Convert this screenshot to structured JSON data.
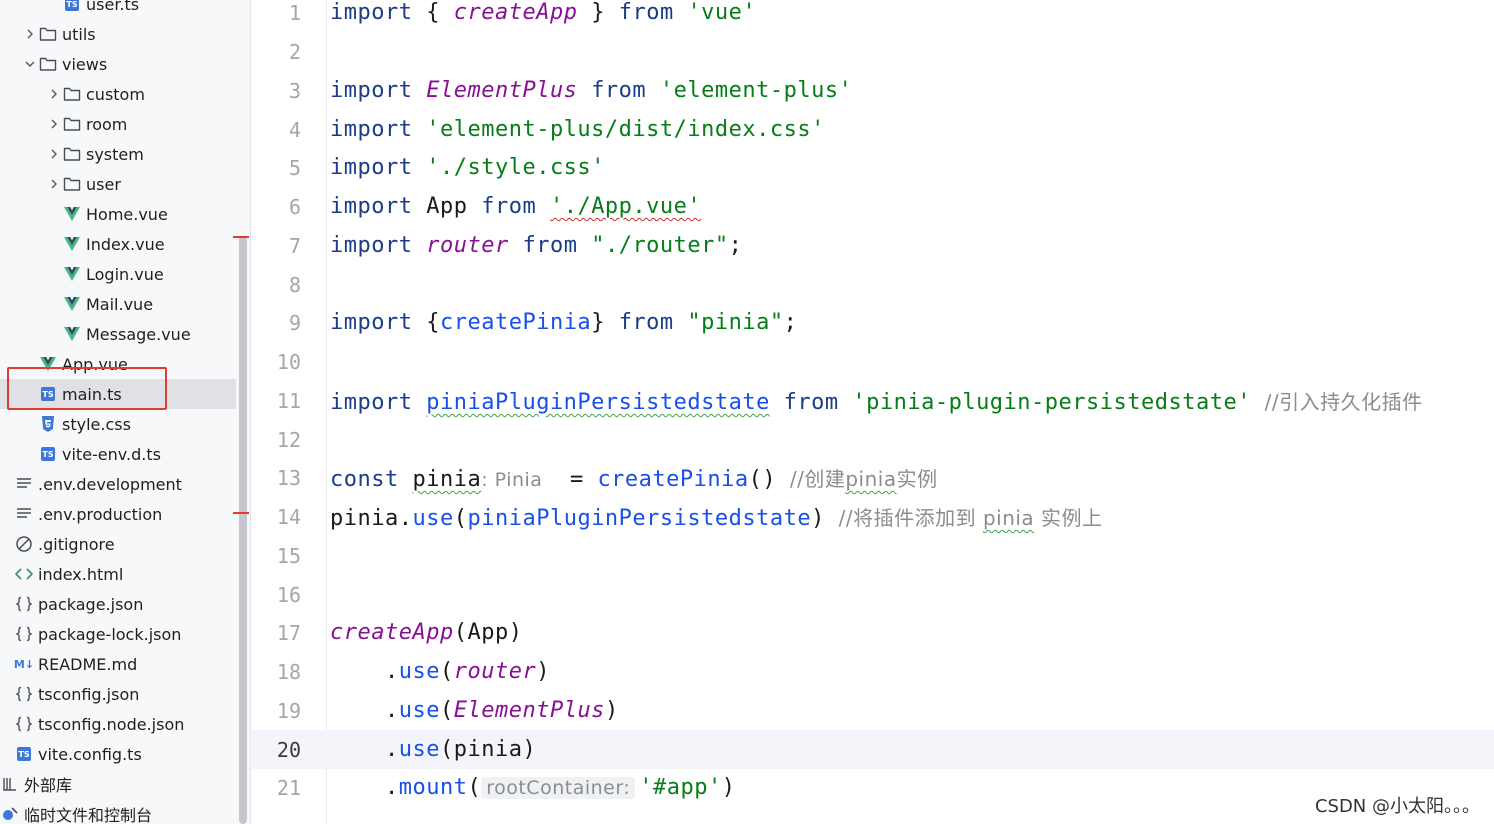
{
  "sidebar": {
    "items": [
      {
        "label": "user.ts",
        "icon": "ts-file-icon",
        "kind": "file",
        "depth": 2
      },
      {
        "label": "utils",
        "icon": "folder-icon",
        "kind": "folder-collapsed",
        "depth": 1
      },
      {
        "label": "views",
        "icon": "folder-icon",
        "kind": "folder-expanded",
        "depth": 1
      },
      {
        "label": "custom",
        "icon": "folder-icon",
        "kind": "folder-collapsed",
        "depth": 2
      },
      {
        "label": "room",
        "icon": "folder-icon",
        "kind": "folder-collapsed",
        "depth": 2
      },
      {
        "label": "system",
        "icon": "folder-icon",
        "kind": "folder-collapsed",
        "depth": 2
      },
      {
        "label": "user",
        "icon": "folder-icon",
        "kind": "folder-collapsed",
        "depth": 2
      },
      {
        "label": "Home.vue",
        "icon": "vue-file-icon",
        "kind": "file",
        "depth": 2
      },
      {
        "label": "Index.vue",
        "icon": "vue-file-icon",
        "kind": "file",
        "depth": 2
      },
      {
        "label": "Login.vue",
        "icon": "vue-file-icon",
        "kind": "file",
        "depth": 2
      },
      {
        "label": "Mail.vue",
        "icon": "vue-file-icon",
        "kind": "file",
        "depth": 2
      },
      {
        "label": "Message.vue",
        "icon": "vue-file-icon",
        "kind": "file",
        "depth": 2
      },
      {
        "label": "App.vue",
        "icon": "vue-file-icon",
        "kind": "file",
        "depth": 1
      },
      {
        "label": "main.ts",
        "icon": "ts-file-icon",
        "kind": "file",
        "depth": 1,
        "selected": true
      },
      {
        "label": "style.css",
        "icon": "css-file-icon",
        "kind": "file",
        "depth": 1
      },
      {
        "label": "vite-env.d.ts",
        "icon": "ts-file-icon",
        "kind": "file",
        "depth": 1
      },
      {
        "label": ".env.development",
        "icon": "text-file-icon",
        "kind": "file",
        "depth": 0
      },
      {
        "label": ".env.production",
        "icon": "text-file-icon",
        "kind": "file",
        "depth": 0
      },
      {
        "label": ".gitignore",
        "icon": "ignore-file-icon",
        "kind": "file",
        "depth": 0
      },
      {
        "label": "index.html",
        "icon": "html-file-icon",
        "kind": "file",
        "depth": 0
      },
      {
        "label": "package.json",
        "icon": "json-file-icon",
        "kind": "file",
        "depth": 0
      },
      {
        "label": "package-lock.json",
        "icon": "json-file-icon",
        "kind": "file",
        "depth": 0
      },
      {
        "label": "README.md",
        "icon": "markdown-file-icon",
        "kind": "file",
        "depth": 0
      },
      {
        "label": "tsconfig.json",
        "icon": "json-file-icon",
        "kind": "file",
        "depth": 0
      },
      {
        "label": "tsconfig.node.json",
        "icon": "json-file-icon",
        "kind": "file",
        "depth": 0
      },
      {
        "label": "vite.config.ts",
        "icon": "ts-file-icon",
        "kind": "file",
        "depth": 0
      },
      {
        "label": "外部库",
        "icon": "library-icon",
        "kind": "root",
        "depth": -1
      },
      {
        "label": "临时文件和控制台",
        "icon": "scratch-icon",
        "kind": "root",
        "depth": -1
      }
    ]
  },
  "editor": {
    "line_numbers": [
      "1",
      "2",
      "3",
      "4",
      "5",
      "6",
      "7",
      "8",
      "9",
      "10",
      "11",
      "12",
      "13",
      "14",
      "15",
      "16",
      "17",
      "18",
      "19",
      "20",
      "21"
    ],
    "current_line": "20",
    "lines": {
      "l1": {
        "a": "import",
        "b": " { ",
        "c": "createApp",
        "d": " } ",
        "e": "from",
        "f": " ",
        "g": "'vue'"
      },
      "l3": {
        "a": "import",
        "b": " ",
        "c": "ElementPlus",
        "d": " ",
        "e": "from",
        "f": " ",
        "g": "'element-plus'"
      },
      "l4": {
        "a": "import",
        "b": " ",
        "g": "'element-plus/dist/index.css'"
      },
      "l5": {
        "a": "import",
        "b": " ",
        "g": "'./style.css'"
      },
      "l6": {
        "a": "import",
        "b": " App ",
        "e": "from",
        "f": " ",
        "g": "'./App.vue'"
      },
      "l7": {
        "a": "import",
        "b": " ",
        "c": "router",
        "d": " ",
        "e": "from",
        "f": " ",
        "g": "\"./router\"",
        "h": ";"
      },
      "l9": {
        "a": "import",
        "b": " {",
        "c": "createPinia",
        "d": "} ",
        "e": "from",
        "f": " ",
        "g": "\"pinia\"",
        "h": ";"
      },
      "l11": {
        "a": "import",
        "b": " ",
        "c": "piniaPluginPersistedstate",
        "d": " ",
        "e": "from",
        "f": " ",
        "g": "'pinia-plugin-persistedstate'",
        "h": "  //引入持久化插件"
      },
      "l13": {
        "a": "const",
        "b": " ",
        "c": "pinia",
        "hint": ": Pinia",
        "d": "  = ",
        "e": "createPinia",
        "f": "()",
        "cm1": "  //创建",
        "cm2": "pinia",
        "cm3": "实例"
      },
      "l14": {
        "a": "pinia",
        "b": ".",
        "c": "use",
        "d": "(",
        "e": "piniaPluginPersistedstate",
        "f": ")",
        "cm1": "  //将插件添加到 ",
        "cm2": "pinia",
        "cm3": " 实例上"
      },
      "l17": {
        "a": "createApp",
        "b": "(App)"
      },
      "l18": {
        "a": "    .",
        "b": "use",
        "c": "(",
        "d": "router",
        "e": ")"
      },
      "l19": {
        "a": "    .",
        "b": "use",
        "c": "(",
        "d": "ElementPlus",
        "e": ")"
      },
      "l20": {
        "a": "    .",
        "b": "use",
        "c": "(pinia)"
      },
      "l21": {
        "a": "    .",
        "b": "mount",
        "c": "(",
        "hint": "rootContainer:",
        "d": "'#app'",
        "e": ")"
      }
    }
  },
  "watermark": "CSDN @小太阳。。。"
}
